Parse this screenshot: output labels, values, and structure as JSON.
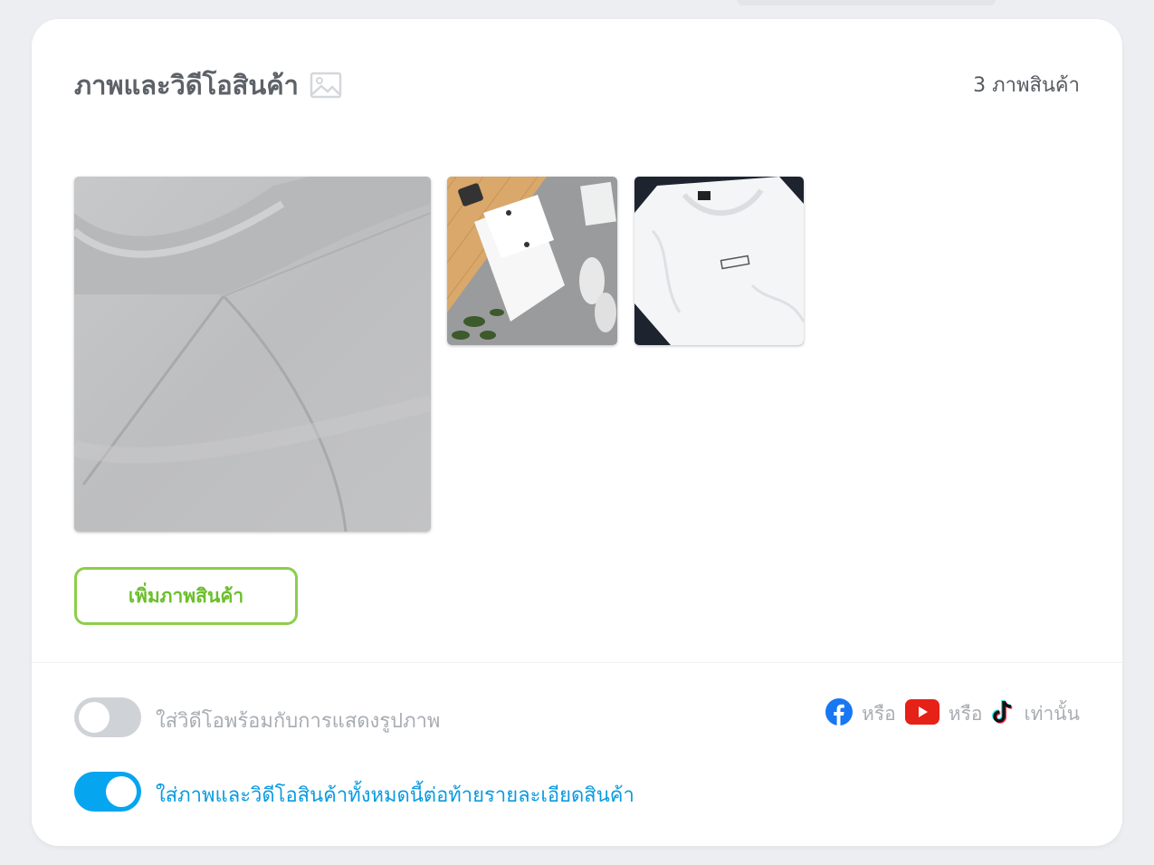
{
  "section": {
    "title": "ภาพและวิดีโอสินค้า",
    "title_icon": "image-icon",
    "image_count_label": "3 ภาพสินค้า"
  },
  "images": [
    {
      "name": "product-image-main",
      "description_icon": "white-tshirt-fabric-closeup"
    },
    {
      "name": "product-image-2",
      "description_icon": "white-tshirts-flatlay"
    },
    {
      "name": "product-image-3",
      "description_icon": "white-tshirt-hotel-print"
    }
  ],
  "add_button": {
    "label": "เพิ่มภาพสินค้า"
  },
  "video_toggle": {
    "label": "ใส่วิดีโอพร้อมกับการแสดงรูปภาพ",
    "checked": false
  },
  "platforms": {
    "or_1": "หรือ",
    "or_2": "หรือ",
    "suffix": "เท่านั้น",
    "icons": [
      "facebook-icon",
      "youtube-icon",
      "tiktok-icon"
    ]
  },
  "append_toggle": {
    "label": "ใส่ภาพและวิดีโอสินค้าทั้งหมดนี้ต่อท้ายรายละเอียดสินค้า",
    "checked": true
  },
  "colors": {
    "accent_green": "#6cbf2b",
    "toggle_on": "#06a5ef",
    "toggle_off": "#cfd3d8",
    "facebook": "#1877f2",
    "youtube": "#e62117"
  }
}
